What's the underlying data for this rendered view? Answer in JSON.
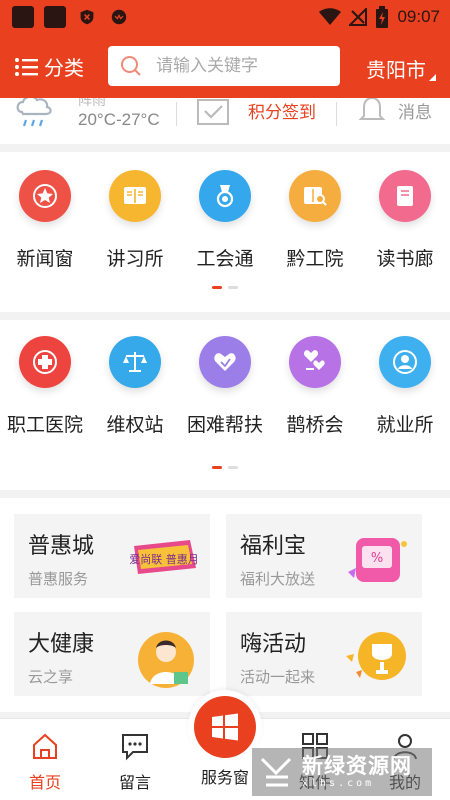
{
  "status_bar": {
    "time": "09:07"
  },
  "header": {
    "menu_label": "分类",
    "search_placeholder": "请输入关键字",
    "city": "贵阳市"
  },
  "strip": {
    "weather_partial": "阵雨",
    "temperature": "20°C-27°C",
    "checkin": "积分签到",
    "messages": "消息"
  },
  "grid1": [
    {
      "label": "新闻窗",
      "icon": "star-icon",
      "color": "#ee5146"
    },
    {
      "label": "讲习所",
      "icon": "book-open-icon",
      "color": "#f7b630"
    },
    {
      "label": "工会通",
      "icon": "medal-icon",
      "color": "#35a7ec"
    },
    {
      "label": "黔工院",
      "icon": "book-search-icon",
      "color": "#f6ad3f"
    },
    {
      "label": "读书廊",
      "icon": "book-icon",
      "color": "#f26b8e"
    }
  ],
  "grid2": [
    {
      "label": "职工医院",
      "icon": "medical-cross-icon",
      "color": "#ee4440"
    },
    {
      "label": "维权站",
      "icon": "scales-icon",
      "color": "#35a9e9"
    },
    {
      "label": "困难帮扶",
      "icon": "heart-hand-icon",
      "color": "#9c7ee9"
    },
    {
      "label": "鹊桥会",
      "icon": "hearts-icon",
      "color": "#b772e6"
    },
    {
      "label": "就业所",
      "icon": "person-badge-icon",
      "color": "#3fb0ef"
    }
  ],
  "cards": [
    {
      "title": "普惠城",
      "subtitle": "普惠服务",
      "art_text": "爱尚联 普惠月"
    },
    {
      "title": "福利宝",
      "subtitle": "福利大放送"
    },
    {
      "title": "大健康",
      "subtitle": "云之享"
    },
    {
      "title": "嗨活动",
      "subtitle": "活动一起来"
    }
  ],
  "bottom_nav": [
    {
      "label": "首页",
      "icon": "home-icon"
    },
    {
      "label": "留言",
      "icon": "chat-icon"
    },
    {
      "label": "服务窗",
      "icon": "windows-icon"
    },
    {
      "label": "知件",
      "icon": "apps-grid-icon"
    },
    {
      "label": "我的",
      "icon": "user-icon"
    }
  ],
  "watermark": {
    "main": "新绿资源网",
    "sub": "xlhs.com"
  },
  "colors": {
    "brand": "#e9401f",
    "background": "#f2f2f2"
  }
}
